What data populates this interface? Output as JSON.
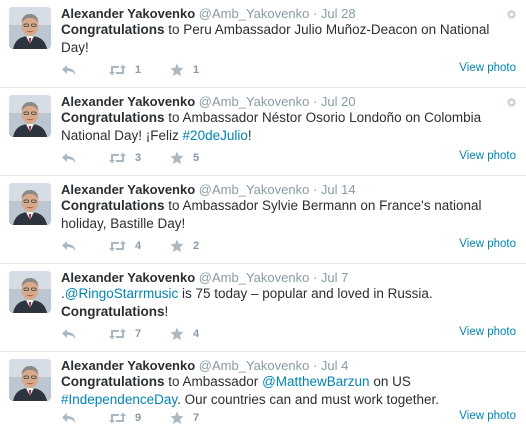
{
  "tweets": [
    {
      "name": "Alexander Yakovenko",
      "handle": "@Amb_Yakovenko",
      "sep": "·",
      "time": "Jul 28",
      "text_bold": "Congratulations",
      "text_a": " to Peru Ambassador Julio Muñoz-Deacon on National Day!",
      "link": "",
      "text_b": "",
      "link2": "",
      "text_c": "",
      "retweets": "1",
      "favorites": "1",
      "view": "View photo"
    },
    {
      "name": "Alexander Yakovenko",
      "handle": "@Amb_Yakovenko",
      "sep": "·",
      "time": "Jul 20",
      "text_bold": "Congratulations",
      "text_a": " to Ambassador Néstor Osorio Londoño on Colombia National Day! ¡Feliz ",
      "link": "#20deJulio",
      "text_b": "!",
      "link2": "",
      "text_c": "",
      "retweets": "3",
      "favorites": "5",
      "view": "View photo"
    },
    {
      "name": "Alexander Yakovenko",
      "handle": "@Amb_Yakovenko",
      "sep": "·",
      "time": "Jul 14",
      "text_bold": "Congratulations",
      "text_a": " to Ambassador Sylvie Bermann on France's national holiday, Bastille Day!",
      "link": "",
      "text_b": "",
      "link2": "",
      "text_c": "",
      "retweets": "4",
      "favorites": "2",
      "view": "View photo"
    },
    {
      "name": "Alexander Yakovenko",
      "handle": "@Amb_Yakovenko",
      "sep": "·",
      "time": "Jul 7",
      "pre": ".",
      "link": "@RingoStarrmusic",
      "text_a": " is 75 today – popular and loved in Russia. ",
      "text_bold": "Congratulations",
      "text_b": "!",
      "retweets": "7",
      "favorites": "4",
      "view": "View photo"
    },
    {
      "name": "Alexander Yakovenko",
      "handle": "@Amb_Yakovenko",
      "sep": "·",
      "time": "Jul 4",
      "text_bold": "Congratulations",
      "text_a": " to Ambassador ",
      "link": "@MatthewBarzun",
      "text_b": " on US ",
      "link2": "#IndependenceDay",
      "text_c": ". Our countries can and must work together.",
      "retweets": "9",
      "favorites": "7",
      "view": "View photo"
    }
  ],
  "colors": {
    "link": "#0084b4",
    "muted": "#8899a6",
    "text": "#292f33",
    "divider": "#e1e8ed"
  },
  "icons": {
    "reply": "reply-icon",
    "retweet": "retweet-icon",
    "favorite": "star-icon",
    "settings": "gear-icon"
  }
}
